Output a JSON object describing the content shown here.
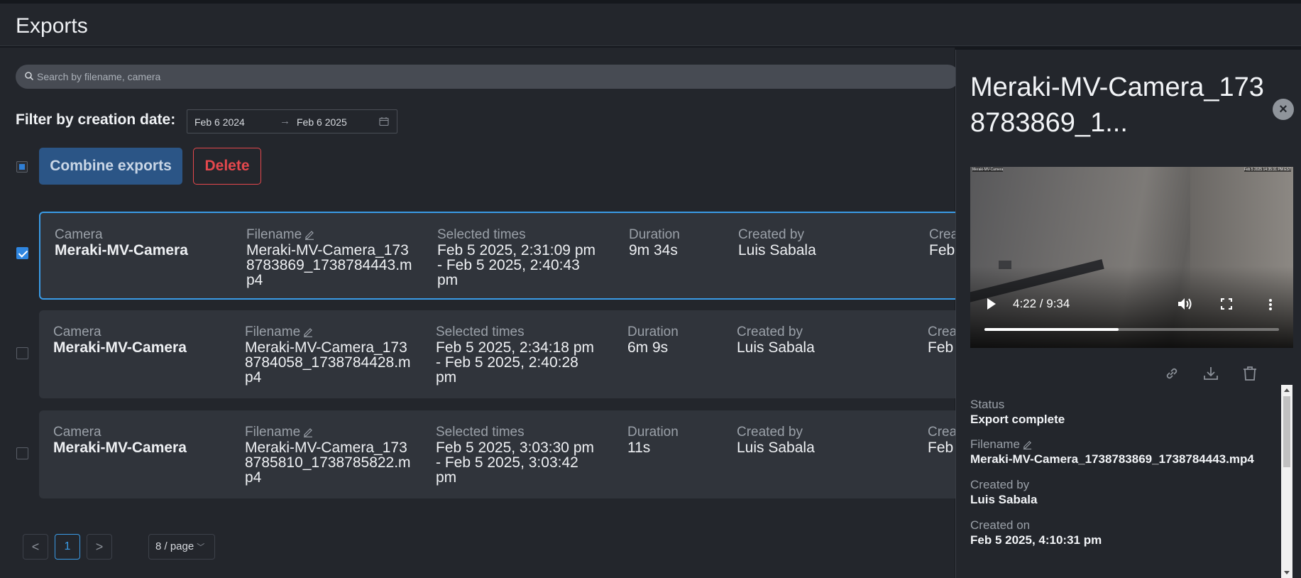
{
  "header": {
    "title": "Exports"
  },
  "search": {
    "placeholder": "Search by filename, camera"
  },
  "filter": {
    "label": "Filter by creation date:",
    "from": "Feb 6 2024",
    "to": "Feb 6 2025"
  },
  "toolbar": {
    "combine_label": "Combine exports",
    "delete_label": "Delete"
  },
  "labels": {
    "camera": "Camera",
    "filename": "Filename",
    "selected_times": "Selected times",
    "duration": "Duration",
    "created_by": "Created by",
    "created_on_truncated": "Crea"
  },
  "rows": [
    {
      "camera": "Meraki-MV-Camera",
      "filename": "Meraki-MV-Camera_1738783869_1738784443.mp4",
      "selected_times": "Feb 5 2025, 2:31:09 pm - Feb 5 2025, 2:40:43 pm",
      "duration": "9m 34s",
      "created_by": "Luis Sabala",
      "created_on_truncated": "Feb",
      "checked": true
    },
    {
      "camera": "Meraki-MV-Camera",
      "filename": "Meraki-MV-Camera_1738784058_1738784428.mp4",
      "selected_times": "Feb 5 2025, 2:34:18 pm - Feb 5 2025, 2:40:28 pm",
      "duration": "6m 9s",
      "created_by": "Luis Sabala",
      "created_on_truncated": "Feb",
      "checked": false
    },
    {
      "camera": "Meraki-MV-Camera",
      "filename": "Meraki-MV-Camera_1738785810_1738785822.mp4",
      "selected_times": "Feb 5 2025, 3:03:30 pm - Feb 5 2025, 3:03:42 pm",
      "duration": "11s",
      "created_by": "Luis Sabala",
      "created_on_truncated": "Feb",
      "checked": false
    }
  ],
  "pagination": {
    "prev": "<",
    "current": "1",
    "next": ">",
    "page_size": "8 / page"
  },
  "drawer": {
    "title": "Meraki-MV-Camera_1738783869_1...",
    "close": "×",
    "video": {
      "overlay_left": "Meraki-MV-Camera",
      "overlay_right": "Feb 5 2025 14:35:31 PM EST",
      "time": "4:22 / 9:34",
      "progress": 0.455
    },
    "details": {
      "status_label": "Status",
      "status_value": "Export complete",
      "filename_label": "Filename",
      "filename_value": "Meraki-MV-Camera_1738783869_1738784443.mp4",
      "created_by_label": "Created by",
      "created_by_value": "Luis Sabala",
      "created_on_label": "Created on",
      "created_on_value": "Feb 5 2025, 4:10:31 pm"
    },
    "icons": [
      "link-icon",
      "download-icon",
      "trash-icon"
    ]
  },
  "colors": {
    "accent": "#3a9be6",
    "danger": "#e5484d",
    "combine_bg": "#2b5586",
    "panel": "#23262c",
    "row": "#30343b"
  }
}
